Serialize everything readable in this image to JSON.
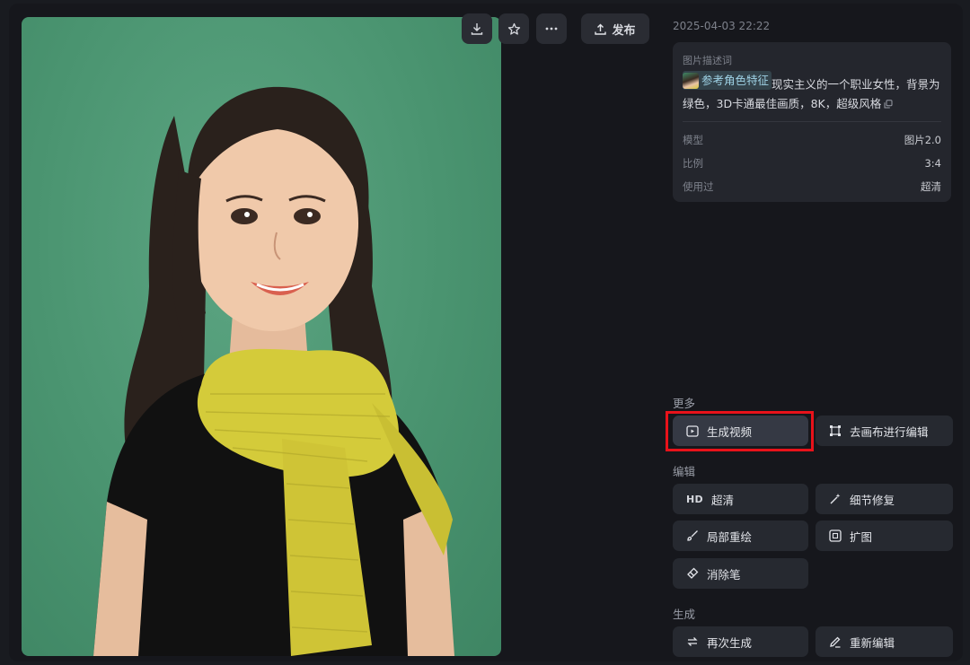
{
  "toolbar": {
    "download_icon": "download-icon",
    "favorite_icon": "star-icon",
    "more_icon": "more-icon",
    "publish_label": "发布"
  },
  "timestamp": "2025-04-03 22:22",
  "prompt": {
    "title": "图片描述词",
    "ref_label": "参考角色特征",
    "text_line1": "现实主义的一个职业女性，背景为",
    "text_line2": "绿色，3D卡通最佳画质，8K，超级风格"
  },
  "meta": {
    "model_label": "模型",
    "model_value": "图片2.0",
    "ratio_label": "比例",
    "ratio_value": "3:4",
    "used_label": "使用过",
    "used_value": "超清"
  },
  "sections": {
    "more": "更多",
    "edit": "编辑",
    "generate": "生成"
  },
  "actions": {
    "generate_video": "生成视频",
    "canvas_edit": "去画布进行编辑",
    "hd_badge": "HD",
    "super_res": "超清",
    "detail_fix": "细节修复",
    "inpaint": "局部重绘",
    "expand": "扩图",
    "eraser": "消除笔",
    "regenerate": "再次生成",
    "reedit": "重新编辑"
  },
  "colors": {
    "background": "#191b20",
    "panel": "#24262d",
    "button": "#262930",
    "highlight_box": "#e8121a",
    "image_background": "#4a9470"
  }
}
